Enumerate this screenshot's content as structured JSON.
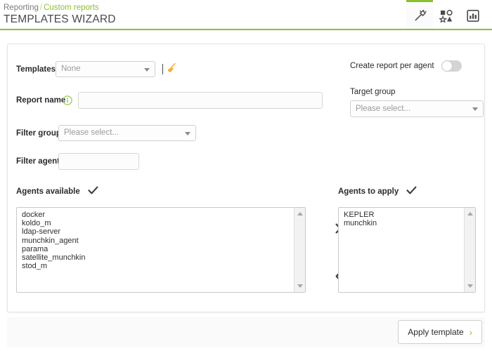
{
  "header": {
    "breadcrumb": {
      "root": "Reporting",
      "separator": "/",
      "current": "Custom reports"
    },
    "title": "TEMPLATES WIZARD",
    "accent_color": "#8bc02f",
    "icons": [
      {
        "name": "magic-wand-icon",
        "label": "Templates wizard",
        "active": true
      },
      {
        "name": "shapes-icon",
        "label": "Report elements",
        "active": false
      },
      {
        "name": "report-chart-icon",
        "label": "Report preview",
        "active": false
      }
    ]
  },
  "form": {
    "templates": {
      "label": "Templates",
      "value": "None",
      "clear_icon": "broom-icon"
    },
    "report_name": {
      "label": "Report name",
      "value": "",
      "placeholder": "",
      "info_icon": "info-circle-icon"
    },
    "filter_group": {
      "label": "Filter group",
      "value": "Please select..."
    },
    "filter_agent": {
      "label": "Filter agent",
      "value": "",
      "placeholder": ""
    },
    "create_report_per_agent": {
      "label": "Create report per agent",
      "enabled": false
    },
    "target_group": {
      "label": "Target group",
      "value": "Please select..."
    }
  },
  "transfer": {
    "available": {
      "label": "Agents available",
      "check_icon": "check-icon",
      "items": [
        "docker",
        "koldo_m",
        "ldap-server",
        "munchkin_agent",
        "parama",
        "satellite_munchkin",
        "stod_m"
      ]
    },
    "applied": {
      "label": "Agents to apply",
      "check_icon": "check-icon",
      "items": [
        "KEPLER",
        "munchkin"
      ]
    },
    "move_right_label": "›",
    "move_left_label": "‹"
  },
  "footer": {
    "apply_button": {
      "label": "Apply template",
      "chevron": "›"
    }
  }
}
